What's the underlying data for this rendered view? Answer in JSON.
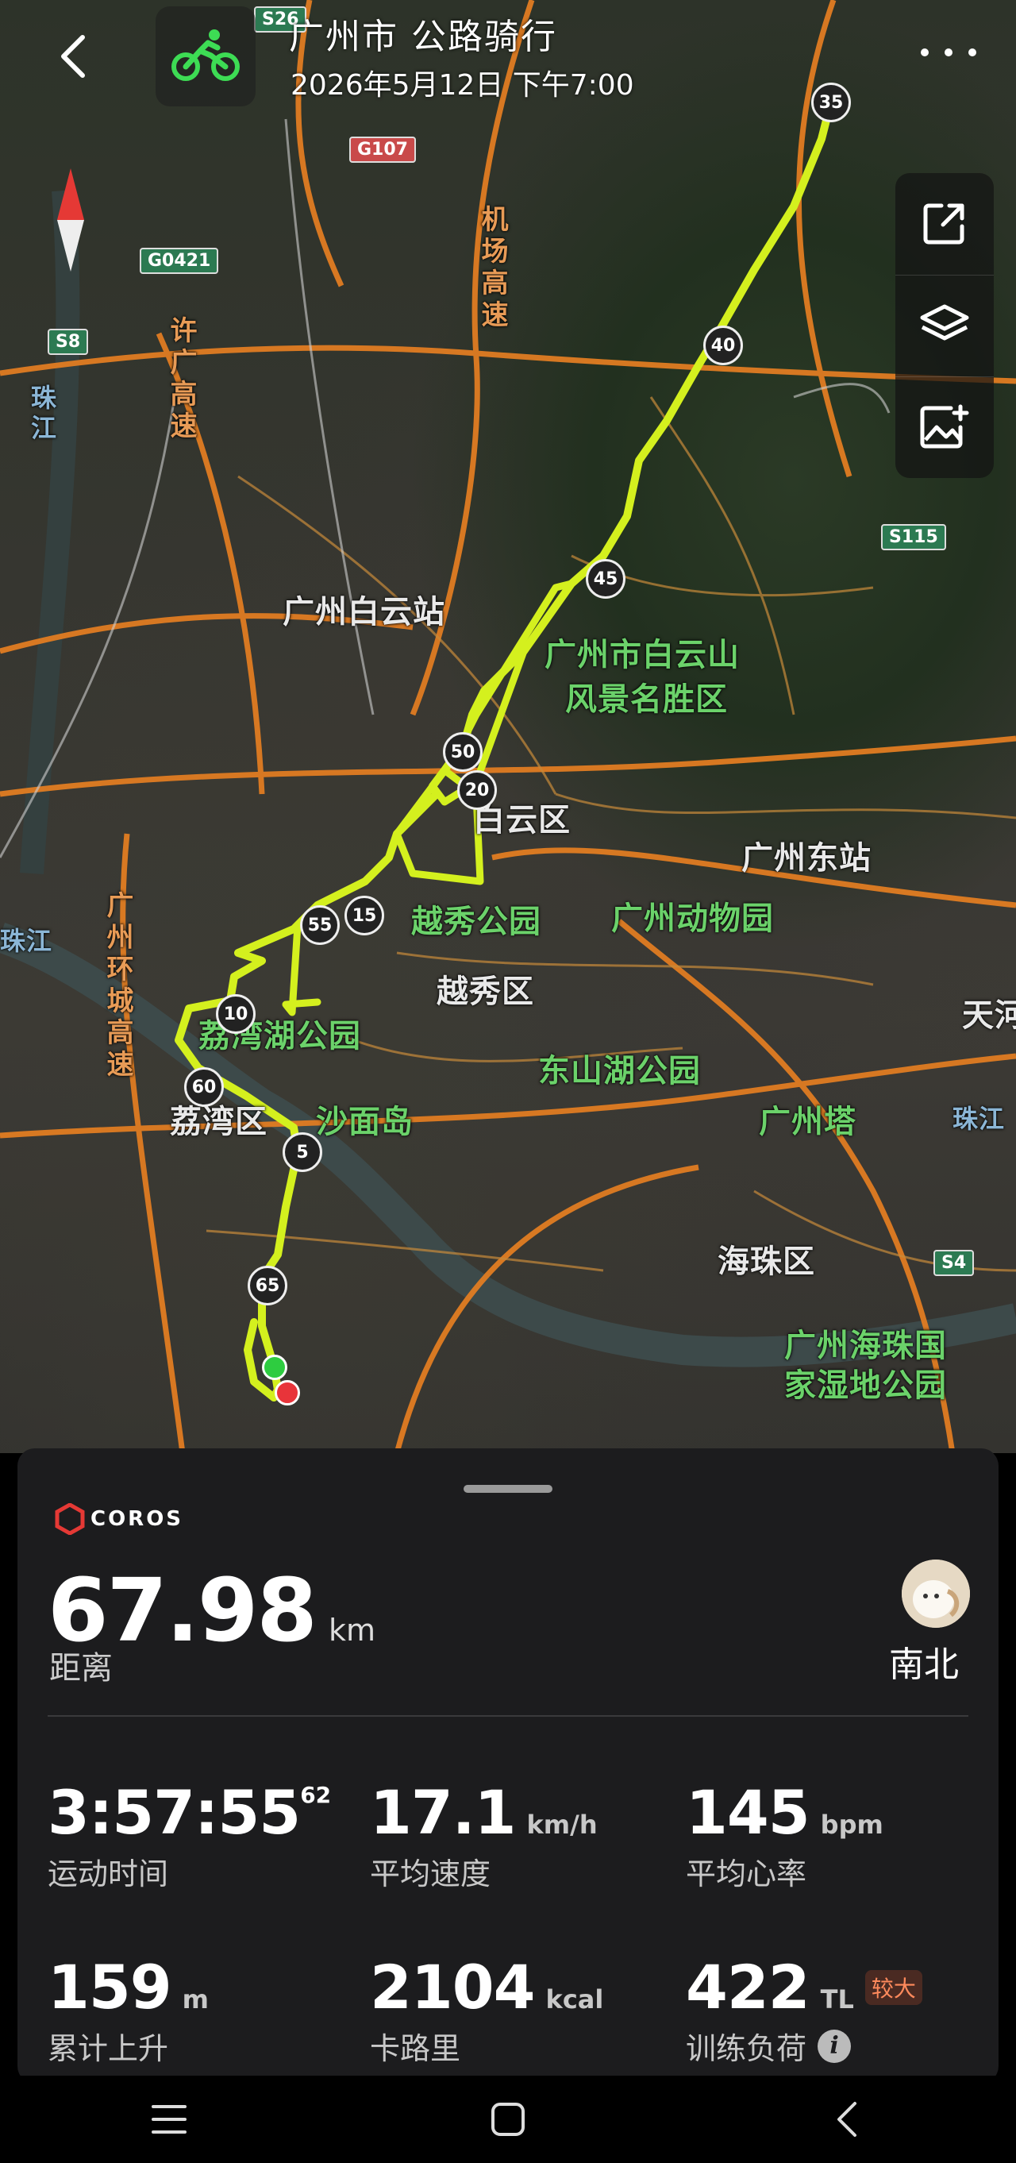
{
  "header": {
    "title": "广州市 公路骑行",
    "datetime": "2026年5月12日 下午7:00",
    "sport_icon": "cycling-icon",
    "accent": "#3ddc54"
  },
  "map": {
    "route_color": "#d4f01e",
    "labels": {
      "baiyun_station": "广州白云站",
      "baiyunshan": "广州市白云山",
      "baiyunshan2": "风景名胜区",
      "baiyun_district": "白云区",
      "east_station": "广州东站",
      "yuexiu_park": "越秀公园",
      "zoo": "广州动物园",
      "yuexiu_district": "越秀区",
      "liwan_lake": "荔湾湖公园",
      "liwan_district": "荔湾区",
      "shamian": "沙面岛",
      "dongshan_lake": "东山湖公园",
      "tower": "广州塔",
      "haizhu_district": "海珠区",
      "wetland1": "广州海珠国",
      "wetland2": "家湿地公园",
      "tianhe": "天河",
      "airport_expressway": "机场高速",
      "xuguang_expressway": "许广高速",
      "ring_expressway": "广州环城高速",
      "pearl_river_1": "珠江",
      "pearl_river_2": "珠江",
      "pearl_river_3": "珠江"
    },
    "shields": {
      "s26": "S26",
      "g107": "G107",
      "g0421": "G0421",
      "s8": "S8",
      "s115": "S115",
      "s4": "S4"
    },
    "km_markers": [
      "35",
      "40",
      "45",
      "50",
      "20",
      "55",
      "15",
      "10",
      "60",
      "5",
      "65"
    ]
  },
  "summary": {
    "brand": "COROS",
    "distance_value": "67.98",
    "distance_unit": "km",
    "distance_label": "距离",
    "username": "南北",
    "stats": [
      {
        "value": "3:57:55",
        "sup": "62",
        "unit": "",
        "label": "运动时间"
      },
      {
        "value": "17.1",
        "sup": "",
        "unit": "km/h",
        "label": "平均速度"
      },
      {
        "value": "145",
        "sup": "",
        "unit": "bpm",
        "label": "平均心率"
      },
      {
        "value": "159",
        "sup": "",
        "unit": "m",
        "label": "累计上升"
      },
      {
        "value": "2104",
        "sup": "",
        "unit": "kcal",
        "label": "卡路里"
      },
      {
        "value": "422",
        "sup": "",
        "unit": "TL",
        "label": "训练负荷",
        "badge": "较大"
      }
    ]
  }
}
